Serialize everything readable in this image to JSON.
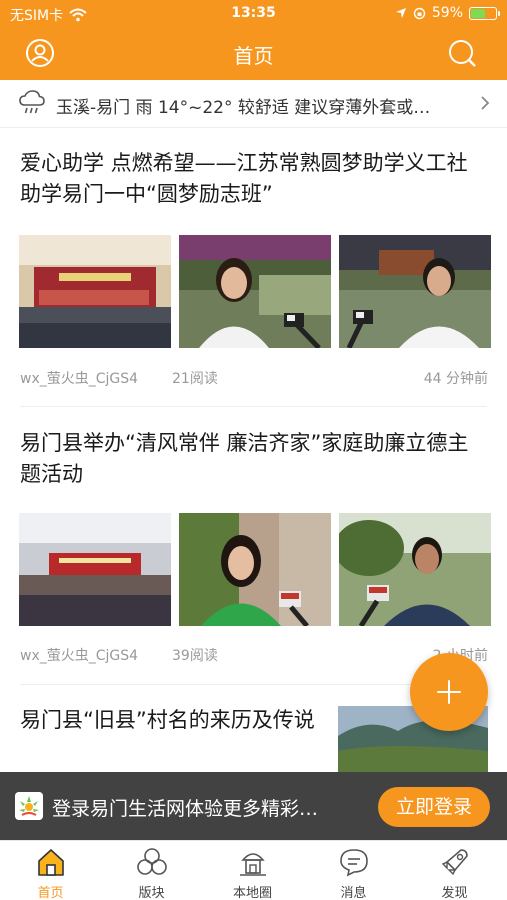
{
  "status_bar": {
    "carrier": "无SIM卡",
    "time": "13:35",
    "battery": "59%",
    "battery_level": 0.59
  },
  "nav": {
    "title": "首页",
    "left_icon": "user-icon",
    "right_icon": "search-icon"
  },
  "weather": {
    "text": "玉溪-易门 雨 14°~22° 较舒适 建议穿薄外套或…",
    "icon": "rain-cloud-icon"
  },
  "articles": [
    {
      "title": "爱心助学 点燃希望——江苏常熟圆梦助学义工社助学易门一中“圆梦励志班”",
      "source": "wx_萤火虫_CjGS4",
      "reads": "21阅读",
      "time": "44 分钟前"
    },
    {
      "title": "易门县举办“清风常伴 廉洁齐家”家庭助廉立德主题活动",
      "source": "wx_萤火虫_CjGS4",
      "reads": "39阅读",
      "time": "2 小时前"
    },
    {
      "title": "易门县“旧县”村名的来历及传说"
    }
  ],
  "fab": {
    "icon": "plus-icon"
  },
  "login_banner": {
    "text": "登录易门生活网体验更多精彩…",
    "button": "立即登录"
  },
  "tabs": [
    {
      "label": "首页",
      "icon": "home-icon",
      "active": true
    },
    {
      "label": "版块",
      "icon": "board-icon",
      "active": false
    },
    {
      "label": "本地圈",
      "icon": "local-circle-icon",
      "active": false
    },
    {
      "label": "消息",
      "icon": "message-icon",
      "active": false
    },
    {
      "label": "发现",
      "icon": "discover-icon",
      "active": false
    }
  ],
  "colors": {
    "accent": "#f7961e",
    "battery_fill": "#7ddc52"
  }
}
